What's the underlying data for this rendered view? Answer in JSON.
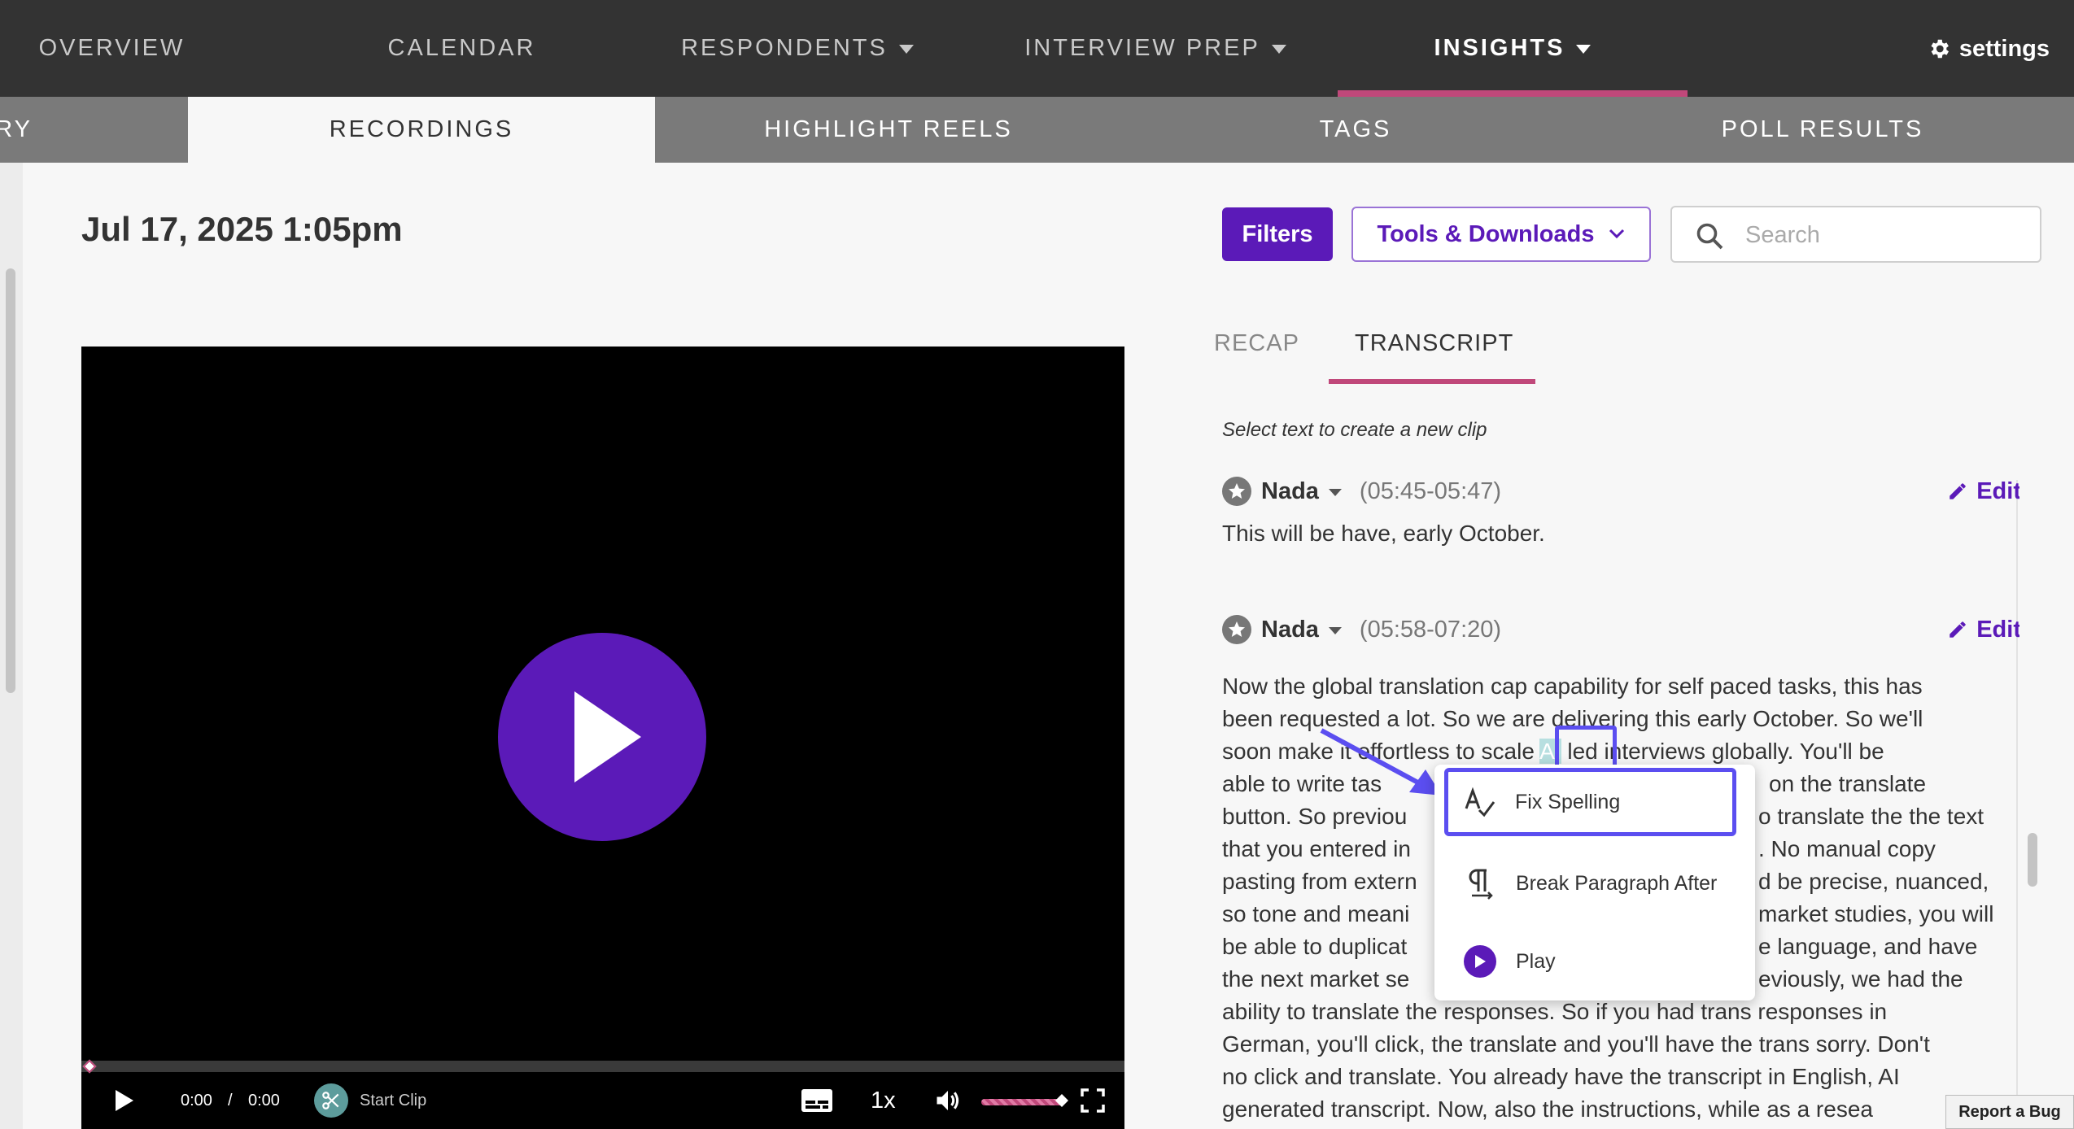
{
  "topnav": {
    "items": [
      {
        "label": "OVERVIEW"
      },
      {
        "label": "CALENDAR"
      },
      {
        "label": "RESPONDENTS"
      },
      {
        "label": "INTERVIEW PREP"
      },
      {
        "label": "INSIGHTS"
      }
    ],
    "settings_label": "settings"
  },
  "subnav": {
    "tabs": [
      {
        "label": "RY"
      },
      {
        "label": "RECORDINGS"
      },
      {
        "label": "HIGHLIGHT REELS"
      },
      {
        "label": "TAGS"
      },
      {
        "label": "POLL RESULTS"
      }
    ]
  },
  "page": {
    "title": "Jul 17, 2025 1:05pm"
  },
  "toolbar": {
    "filters_label": "Filters",
    "tools_label": "Tools & Downloads",
    "search_placeholder": "Search"
  },
  "video": {
    "current_time": "0:00",
    "separator": "/",
    "duration": "0:00",
    "start_clip_label": "Start Clip",
    "playback_rate": "1x"
  },
  "panel": {
    "tabs": [
      {
        "label": "RECAP"
      },
      {
        "label": "TRANSCRIPT"
      }
    ],
    "hint": "Select text to create a new clip",
    "entries": [
      {
        "speaker": "Nada",
        "range": "(05:45-05:47)",
        "edit_label": "Edit",
        "text": "This will be have, early October."
      },
      {
        "speaker": "Nada",
        "range": "(05:58-07:20)",
        "edit_label": "Edit",
        "lines": [
          "Now the global translation cap capability for self paced tasks, this has",
          "been requested a lot. So we are delivering this early October. So we'll",
          "soon make it effortless to scale",
          "AI",
          "led interviews globally. You'll be",
          "able to write tas",
          "on the translate",
          "button. So previou",
          "o translate the the text",
          "that you entered in",
          ". No manual copy",
          "pasting from extern",
          "d be precise, nuanced,",
          "so tone and meani",
          "market studies, you will",
          "be able to duplicat",
          "e language, and have",
          "the next market se",
          "eviously, we had the",
          "ability to translate the responses. So if you had trans responses in",
          "German, you'll click, the translate and you'll have the trans sorry. Don't",
          "no click and translate. You already have the transcript in English, AI",
          "generated transcript. Now, also the instructions, while as a resea"
        ]
      }
    ]
  },
  "context_menu": {
    "items": [
      {
        "label": "Fix Spelling"
      },
      {
        "label": "Break Paragraph After"
      },
      {
        "label": "Play"
      }
    ]
  },
  "report_bug_label": "Report a Bug"
}
